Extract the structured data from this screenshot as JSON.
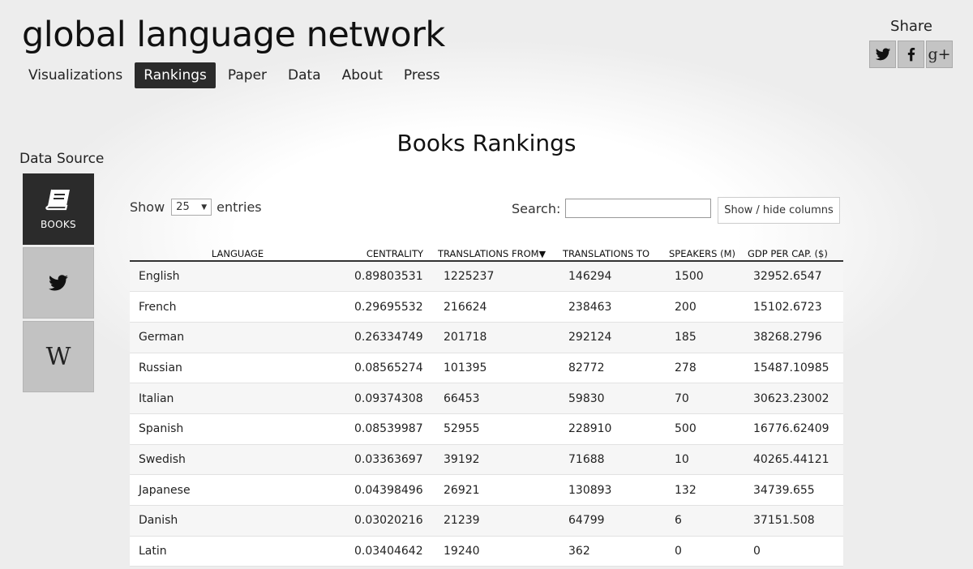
{
  "site": {
    "title": "global language network"
  },
  "nav": {
    "items": [
      {
        "label": "Visualizations",
        "name": "nav-visualizations"
      },
      {
        "label": "Rankings",
        "name": "nav-rankings",
        "active": true
      },
      {
        "label": "Paper",
        "name": "nav-paper"
      },
      {
        "label": "Data",
        "name": "nav-data"
      },
      {
        "label": "About",
        "name": "nav-about"
      },
      {
        "label": "Press",
        "name": "nav-press"
      }
    ]
  },
  "share": {
    "label": "Share",
    "buttons": [
      {
        "icon": "twitter-icon"
      },
      {
        "icon": "facebook-icon"
      },
      {
        "icon": "google-plus-icon",
        "text": "g+"
      }
    ]
  },
  "data_source": {
    "title": "Data Source",
    "tabs": [
      {
        "icon": "book-icon",
        "label": "BOOKS",
        "active": true
      },
      {
        "icon": "twitter-icon",
        "label": ""
      },
      {
        "icon": "wikipedia-icon",
        "glyph": "W"
      }
    ]
  },
  "heading": "Books Rankings",
  "controls": {
    "show_label": "Show",
    "entries_value": "25",
    "entries_suffix": "entries",
    "search_label": "Search:",
    "search_value": "",
    "colvis_label": "Show / hide columns"
  },
  "table": {
    "columns": [
      "LANGUAGE",
      "CENTRALITY",
      "TRANSLATIONS FROM",
      "TRANSLATIONS TO",
      "SPEAKERS (M)",
      "GDP PER CAP. ($)"
    ],
    "sorted_column": "TRANSLATIONS FROM",
    "sort_direction": "descending",
    "rows": [
      [
        "English",
        "0.89803531",
        "1225237",
        "146294",
        "1500",
        "32952.6547"
      ],
      [
        "French",
        "0.29695532",
        "216624",
        "238463",
        "200",
        "15102.6723"
      ],
      [
        "German",
        "0.26334749",
        "201718",
        "292124",
        "185",
        "38268.2796"
      ],
      [
        "Russian",
        "0.08565274",
        "101395",
        "82772",
        "278",
        "15487.10985"
      ],
      [
        "Italian",
        "0.09374308",
        "66453",
        "59830",
        "70",
        "30623.23002"
      ],
      [
        "Spanish",
        "0.08539987",
        "52955",
        "228910",
        "500",
        "16776.62409"
      ],
      [
        "Swedish",
        "0.03363697",
        "39192",
        "71688",
        "10",
        "40265.44121"
      ],
      [
        "Japanese",
        "0.04398496",
        "26921",
        "130893",
        "132",
        "34739.655"
      ],
      [
        "Danish",
        "0.03020216",
        "21239",
        "64799",
        "6",
        "37151.508"
      ],
      [
        "Latin",
        "0.03404642",
        "19240",
        "362",
        "0",
        "0"
      ]
    ]
  }
}
